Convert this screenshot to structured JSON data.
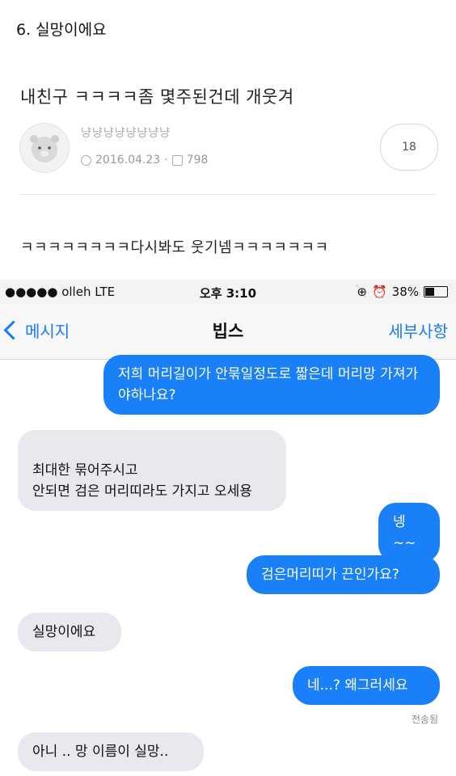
{
  "heading": "6. 실망이에요",
  "post": {
    "title": "내친구 ㅋㅋㅋㅋ좀 몇주된건데 개웃겨",
    "author": "냥냥냥냥냥냥냥냥",
    "date": "2016.04.23",
    "views": "798",
    "comment_count": "18",
    "body": "ㅋㅋㅋㅋㅋㅋㅋㅋ다시봐도 웃기넴ㅋㅋㅋㅋㅋㅋㅋ"
  },
  "phone": {
    "status": {
      "carrier": "●●●●● olleh  LTE",
      "time": "오후 3:10",
      "battery": "38%",
      "battery_level": 0.38
    },
    "nav": {
      "back_label": "메시지",
      "title": "빕스",
      "details_label": "세부사항"
    },
    "messages": [
      {
        "from": "me",
        "text": "저희 머리길이가 안묶일정도로 짧은데 머리망 가져가야하나요?"
      },
      {
        "from": "them",
        "text": "최대한 묶어주시고\n안되면 검은 머리띠라도 가지고 오세용"
      },
      {
        "from": "me",
        "text": "넹~~"
      },
      {
        "from": "me",
        "text": "검은머리띠가 끈인가요?"
      },
      {
        "from": "them",
        "text": "실망이에요"
      },
      {
        "from": "me",
        "text": "네...? 왜그러세요"
      },
      {
        "from": "them",
        "text": "아니 .. 망 이름이 실망.."
      }
    ],
    "delivered": "전송됨"
  },
  "icons": {
    "clock": "clock-icon",
    "views": "document-icon",
    "alarm": "alarm-icon",
    "lock": "rotation-lock-icon",
    "battery": "battery-icon"
  },
  "colors": {
    "outgoing": "#1a80f7",
    "incoming": "#e8e8ee",
    "accent": "#1a7cf5"
  }
}
